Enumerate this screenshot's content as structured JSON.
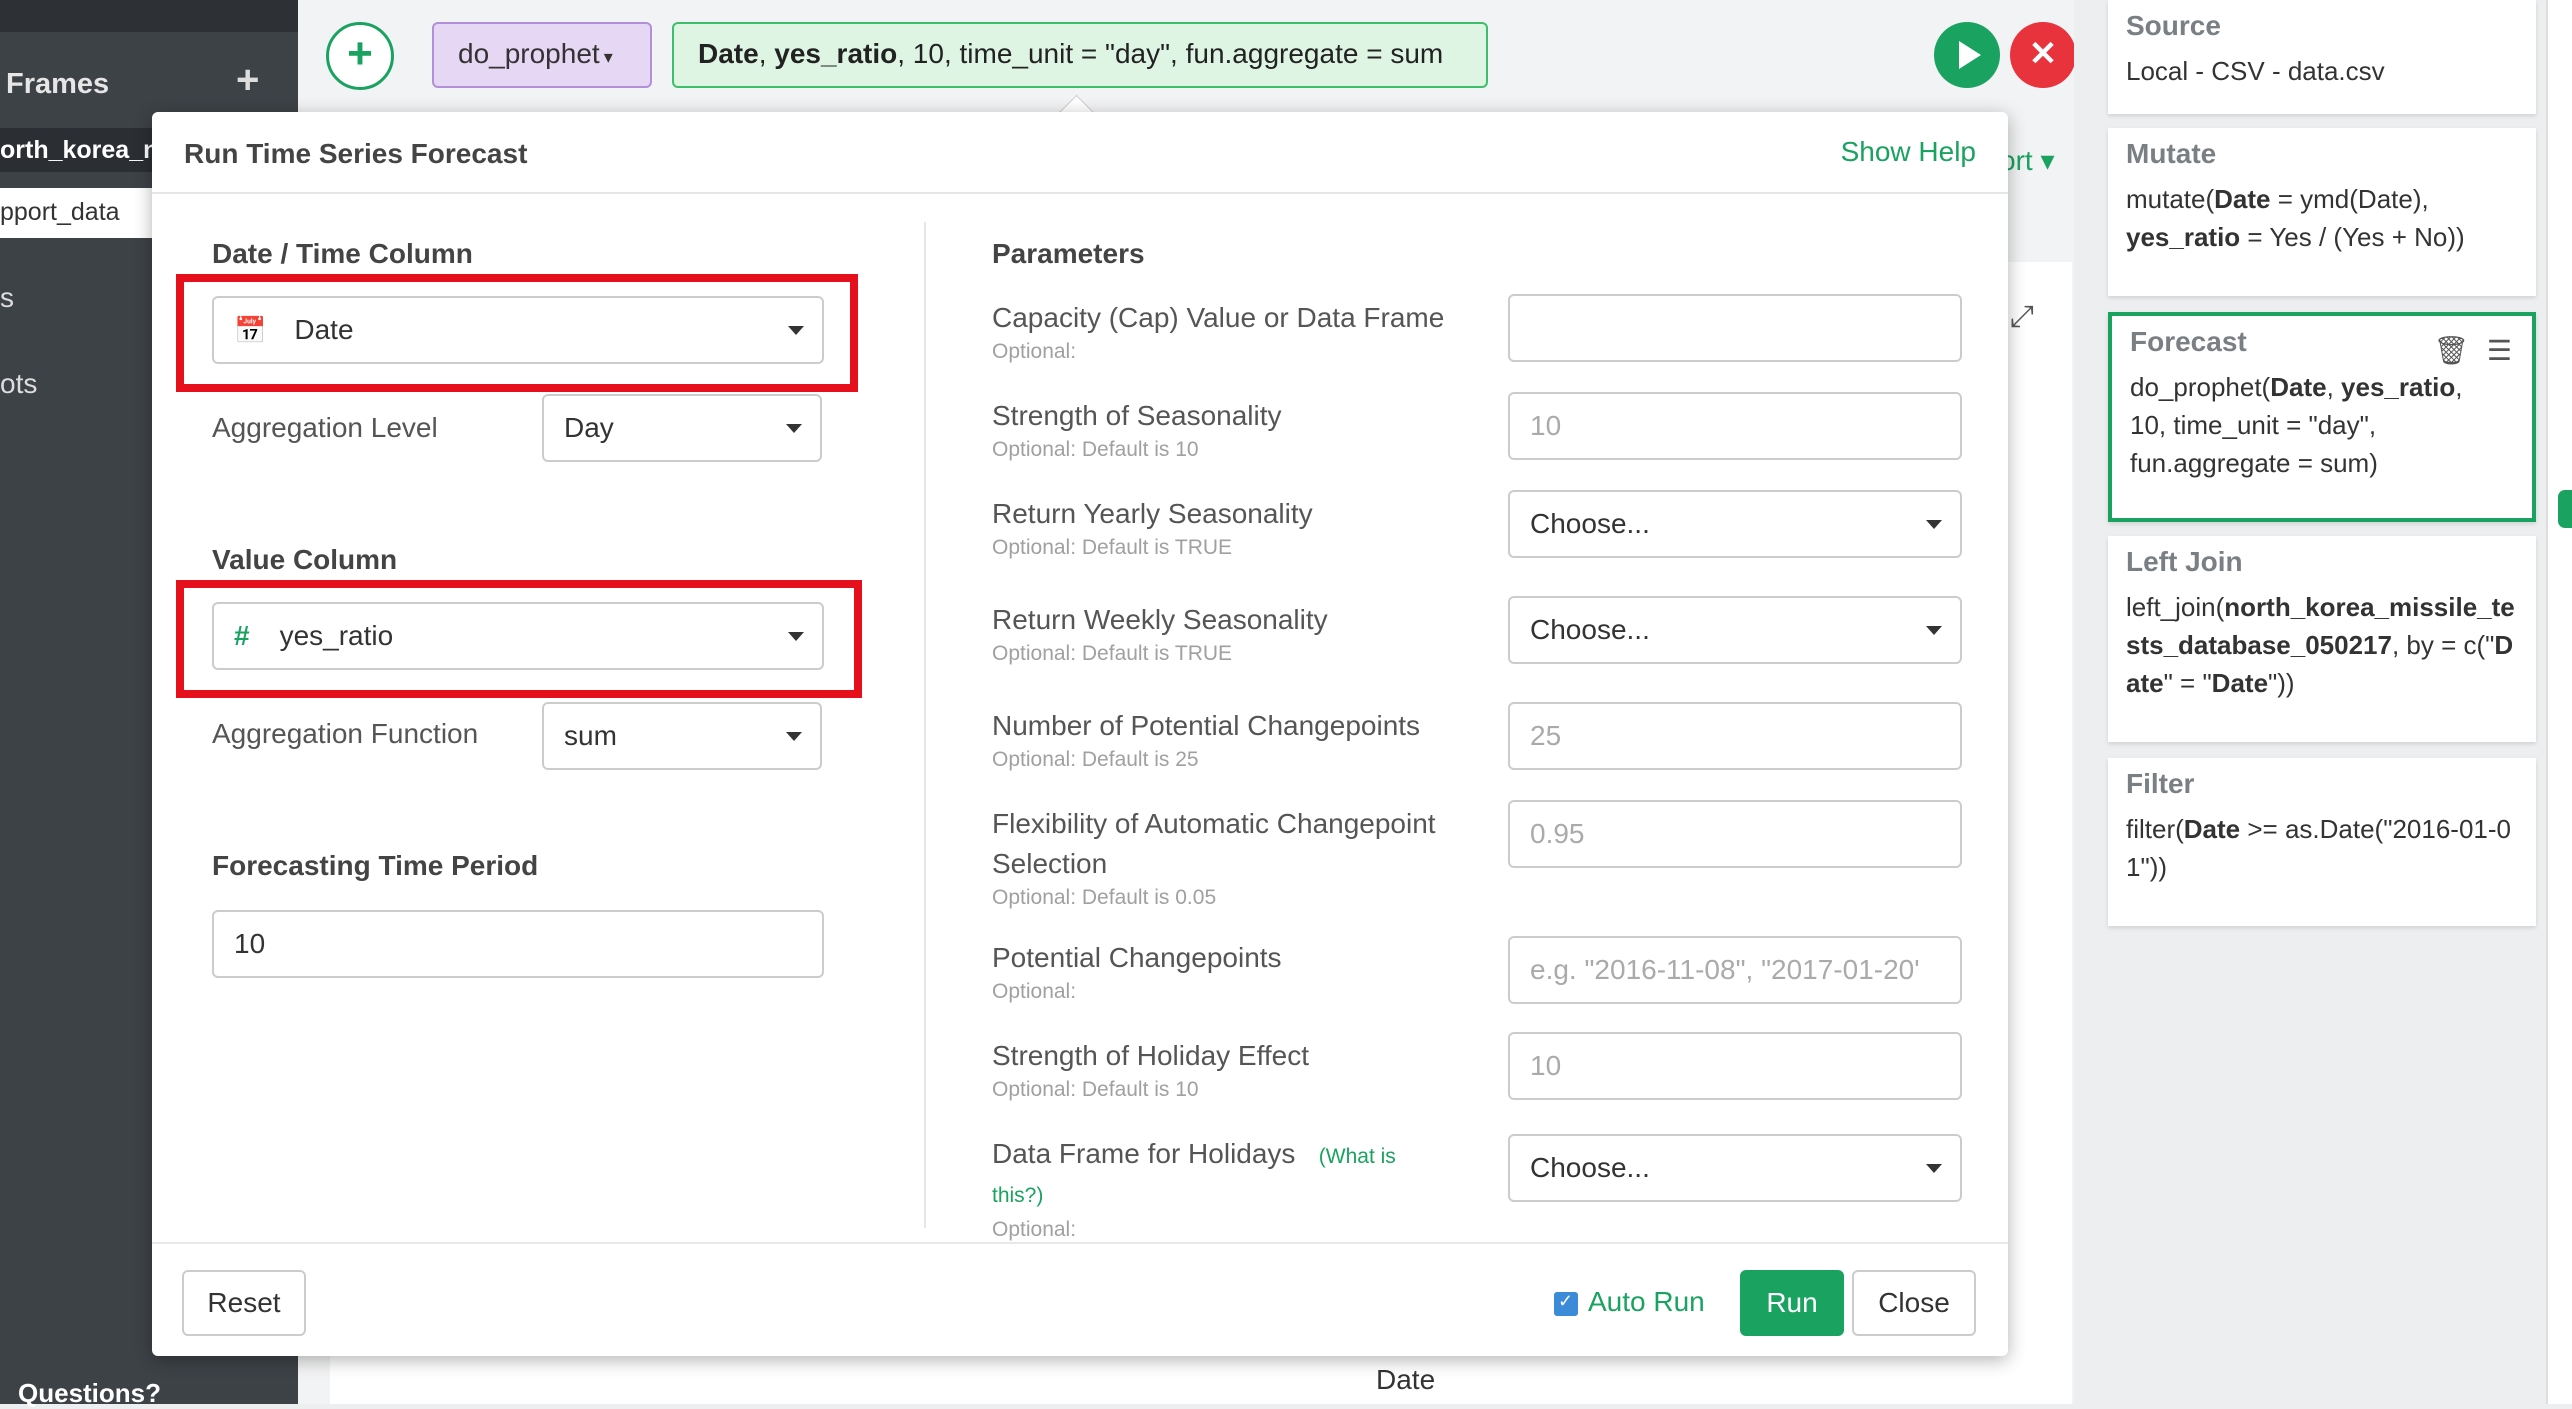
{
  "sidebar": {
    "frames_label": "Frames",
    "add_icon": "+",
    "active_item": "orth_korea_n",
    "selected_item": "pport_data",
    "item_s": "s",
    "item_ots": "ots",
    "questions": "Questions?"
  },
  "toolbar": {
    "add_icon": "+",
    "command": "do_prophet",
    "command_caret": "▾",
    "expr_bold1": "Date",
    "expr_sep1": ", ",
    "expr_bold2": "yes_ratio",
    "expr_rest": ", 10, time_unit = \"day\", fun.aggregate = sum",
    "cancel_icon": "✕",
    "export_fragment": "ort ▾",
    "expand_icon": "⤢"
  },
  "chart_axis_label": "Date",
  "modal": {
    "title": "Run Time Series Forecast",
    "show_help": "Show Help",
    "date_time_column_label": "Date / Time Column",
    "date_column_value": "Date",
    "aggregation_level_label": "Aggregation Level",
    "aggregation_level_value": "Day",
    "value_column_label": "Value Column",
    "value_column_value": "yes_ratio",
    "aggregation_function_label": "Aggregation Function",
    "aggregation_function_value": "sum",
    "forecasting_period_label": "Forecasting Time Period",
    "forecasting_period_value": "10",
    "parameters_label": "Parameters",
    "params": [
      {
        "label": "Capacity (Cap) Value or Data Frame",
        "sub": "Optional:",
        "value": "",
        "placeholder": ""
      },
      {
        "label": "Strength of Seasonality",
        "sub": "Optional: Default is 10",
        "value": "",
        "placeholder": "10"
      },
      {
        "label": "Return Yearly Seasonality",
        "sub": "Optional: Default is TRUE",
        "value": "Choose...",
        "placeholder": ""
      },
      {
        "label": "Return Weekly Seasonality",
        "sub": "Optional: Default is TRUE",
        "value": "Choose...",
        "placeholder": ""
      },
      {
        "label": "Number of Potential Changepoints",
        "sub": "Optional: Default is 25",
        "value": "",
        "placeholder": "25"
      },
      {
        "label": "Flexibility of Automatic Changepoint",
        "label2": "Selection",
        "sub": "Optional: Default is 0.05",
        "value": "",
        "placeholder": "0.95"
      },
      {
        "label": "Potential Changepoints",
        "sub": "Optional:",
        "value": "",
        "placeholder": "e.g. \"2016-11-08\", \"2017-01-20'"
      },
      {
        "label": "Strength of Holiday Effect",
        "sub": "Optional: Default is 10",
        "value": "",
        "placeholder": "10"
      },
      {
        "label": "Data Frame for Holidays",
        "link1": "(What is",
        "link2": "this?)",
        "sub": "Optional:",
        "value": "Choose...",
        "placeholder": ""
      }
    ],
    "reset": "Reset",
    "auto_run": "Auto Run",
    "run": "Run",
    "close": "Close"
  },
  "pipeline": {
    "source": {
      "title": "Source",
      "body": "Local - CSV - data.csv"
    },
    "mutate": {
      "title": "Mutate",
      "l1a": "mutate(",
      "l1b": "Date",
      "l1c": " = ymd(Date),",
      "l2a": "yes_ratio",
      "l2b": " = Yes / (Yes + No))"
    },
    "forecast": {
      "title": "Forecast",
      "trash_icon": "🗑",
      "menu_icon": "☰",
      "l1a": "do_prophet(",
      "l1b": "Date",
      "l1c": ", ",
      "l1d": "yes_ratio",
      "l1e": ",",
      "l2": "10, time_unit = \"day\",",
      "l3": "fun.aggregate = sum)"
    },
    "left_join": {
      "title": "Left Join",
      "a": "left_join(",
      "b": "north_korea_missile_tests_database_050217",
      "c": ", by = c(\"",
      "d": "Date",
      "e": "\" = \"",
      "f": "Date",
      "g": "\"))"
    },
    "filter": {
      "title": "Filter",
      "a": "filter(",
      "b": "Date",
      "c": " >= as.Date(\"2016-01-01\"))"
    }
  }
}
